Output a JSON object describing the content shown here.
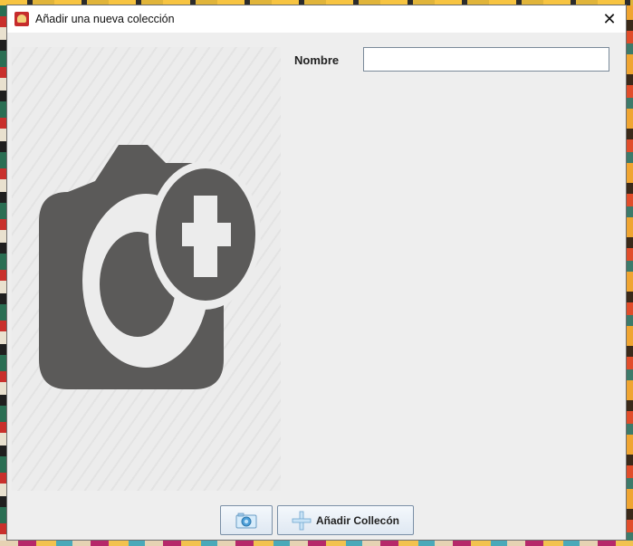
{
  "window": {
    "title": "Añadir una nueva colección",
    "close_glyph": "✕",
    "app_icon": "app-logo-icon"
  },
  "form": {
    "name_label": "Nombre",
    "name_value": "",
    "name_placeholder": ""
  },
  "preview": {
    "icon": "add-photo-camera-icon",
    "icon_color": "#5b5a59"
  },
  "buttons": {
    "photo_icon": "camera-icon",
    "add_label": "Añadir Collecón",
    "add_icon": "plus-icon"
  }
}
